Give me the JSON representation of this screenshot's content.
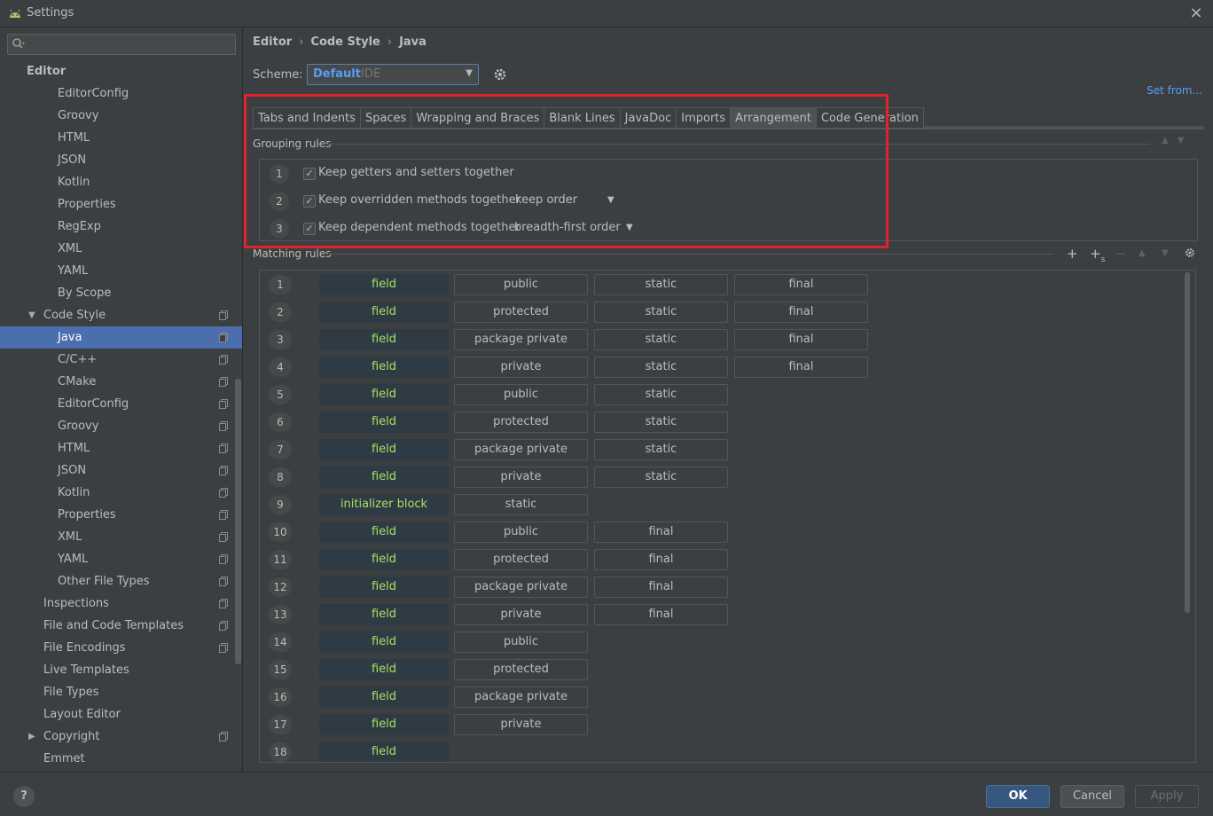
{
  "window": {
    "title": "Settings",
    "icon": "android-icon",
    "close": "×"
  },
  "sidebar": {
    "search_placeholder": "",
    "items": [
      {
        "label": "Editor",
        "level": 0,
        "bold": true
      },
      {
        "label": "EditorConfig",
        "level": 2
      },
      {
        "label": "Groovy",
        "level": 2
      },
      {
        "label": "HTML",
        "level": 2
      },
      {
        "label": "JSON",
        "level": 2
      },
      {
        "label": "Kotlin",
        "level": 2
      },
      {
        "label": "Properties",
        "level": 2
      },
      {
        "label": "RegExp",
        "level": 2
      },
      {
        "label": "XML",
        "level": 2
      },
      {
        "label": "YAML",
        "level": 2
      },
      {
        "label": "By Scope",
        "level": 2
      },
      {
        "label": "Code Style",
        "level": 1,
        "expanded": true,
        "copy": true
      },
      {
        "label": "Java",
        "level": 2,
        "selected": true,
        "copy": true
      },
      {
        "label": "C/C++",
        "level": 2,
        "copy": true
      },
      {
        "label": "CMake",
        "level": 2,
        "copy": true
      },
      {
        "label": "EditorConfig",
        "level": 2,
        "copy": true
      },
      {
        "label": "Groovy",
        "level": 2,
        "copy": true
      },
      {
        "label": "HTML",
        "level": 2,
        "copy": true
      },
      {
        "label": "JSON",
        "level": 2,
        "copy": true
      },
      {
        "label": "Kotlin",
        "level": 2,
        "copy": true
      },
      {
        "label": "Properties",
        "level": 2,
        "copy": true
      },
      {
        "label": "XML",
        "level": 2,
        "copy": true
      },
      {
        "label": "YAML",
        "level": 2,
        "copy": true
      },
      {
        "label": "Other File Types",
        "level": 2,
        "copy": true
      },
      {
        "label": "Inspections",
        "level": 1,
        "copy": true
      },
      {
        "label": "File and Code Templates",
        "level": 1,
        "copy": true
      },
      {
        "label": "File Encodings",
        "level": 1,
        "copy": true
      },
      {
        "label": "Live Templates",
        "level": 1
      },
      {
        "label": "File Types",
        "level": 1
      },
      {
        "label": "Layout Editor",
        "level": 1
      },
      {
        "label": "Copyright",
        "level": 1,
        "collapsed": true,
        "copy": true
      },
      {
        "label": "Emmet",
        "level": 1
      }
    ]
  },
  "breadcrumb": {
    "parts": [
      "Editor",
      "Code Style",
      "Java"
    ],
    "separator": "›"
  },
  "scheme": {
    "label": "Scheme:",
    "name": "Default",
    "kind": "IDE"
  },
  "set_from": "Set from...",
  "tabs": [
    {
      "label": "Tabs and Indents"
    },
    {
      "label": "Spaces"
    },
    {
      "label": "Wrapping and Braces"
    },
    {
      "label": "Blank Lines"
    },
    {
      "label": "JavaDoc"
    },
    {
      "label": "Imports"
    },
    {
      "label": "Arrangement",
      "active": true
    },
    {
      "label": "Code Generation"
    }
  ],
  "grouping": {
    "title": "Grouping rules",
    "rules": [
      {
        "num": "1",
        "checked": true,
        "label": "Keep getters and setters together",
        "option": ""
      },
      {
        "num": "2",
        "checked": true,
        "label": "Keep overridden methods together",
        "option": "keep order"
      },
      {
        "num": "3",
        "checked": true,
        "label": "Keep dependent methods together",
        "option": "breadth-first order"
      }
    ]
  },
  "matching": {
    "title": "Matching rules",
    "tools": [
      "add-icon",
      "add-section-icon",
      "remove-icon",
      "move-up-icon",
      "move-down-icon",
      "gear-icon"
    ],
    "rules": [
      {
        "num": "1",
        "kind": "field",
        "mods": [
          "public",
          "static",
          "final"
        ]
      },
      {
        "num": "2",
        "kind": "field",
        "mods": [
          "protected",
          "static",
          "final"
        ]
      },
      {
        "num": "3",
        "kind": "field",
        "mods": [
          "package private",
          "static",
          "final"
        ]
      },
      {
        "num": "4",
        "kind": "field",
        "mods": [
          "private",
          "static",
          "final"
        ]
      },
      {
        "num": "5",
        "kind": "field",
        "mods": [
          "public",
          "static"
        ]
      },
      {
        "num": "6",
        "kind": "field",
        "mods": [
          "protected",
          "static"
        ]
      },
      {
        "num": "7",
        "kind": "field",
        "mods": [
          "package private",
          "static"
        ]
      },
      {
        "num": "8",
        "kind": "field",
        "mods": [
          "private",
          "static"
        ]
      },
      {
        "num": "9",
        "kind": "initializer block",
        "mods": [
          "static"
        ]
      },
      {
        "num": "10",
        "kind": "field",
        "mods": [
          "public",
          "final"
        ]
      },
      {
        "num": "11",
        "kind": "field",
        "mods": [
          "protected",
          "final"
        ]
      },
      {
        "num": "12",
        "kind": "field",
        "mods": [
          "package private",
          "final"
        ]
      },
      {
        "num": "13",
        "kind": "field",
        "mods": [
          "private",
          "final"
        ]
      },
      {
        "num": "14",
        "kind": "field",
        "mods": [
          "public"
        ]
      },
      {
        "num": "15",
        "kind": "field",
        "mods": [
          "protected"
        ]
      },
      {
        "num": "16",
        "kind": "field",
        "mods": [
          "package private"
        ]
      },
      {
        "num": "17",
        "kind": "field",
        "mods": [
          "private"
        ]
      },
      {
        "num": "18",
        "kind": "field",
        "mods": []
      }
    ]
  },
  "buttons": {
    "help": "?",
    "ok": "OK",
    "cancel": "Cancel",
    "apply": "Apply"
  },
  "colors": {
    "accent": "#4b6eaf",
    "link": "#589df6",
    "rule_kind": "#a8e05f",
    "highlight": "#e0222a"
  }
}
